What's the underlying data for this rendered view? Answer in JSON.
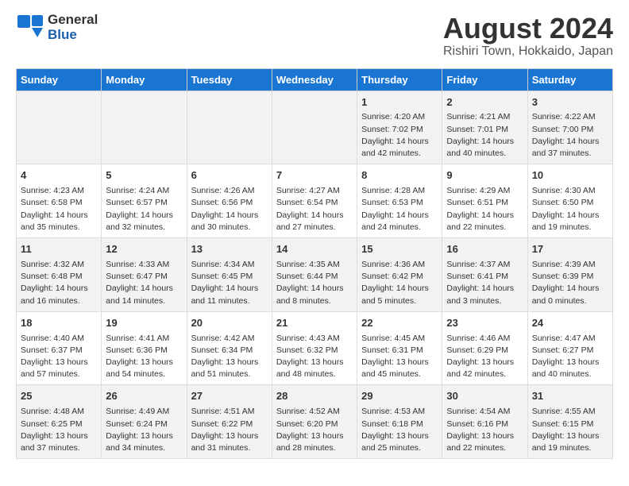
{
  "header": {
    "logo_line1": "General",
    "logo_line2": "Blue",
    "title": "August 2024",
    "subtitle": "Rishiri Town, Hokkaido, Japan"
  },
  "weekdays": [
    "Sunday",
    "Monday",
    "Tuesday",
    "Wednesday",
    "Thursday",
    "Friday",
    "Saturday"
  ],
  "weeks": [
    [
      {
        "day": "",
        "detail": ""
      },
      {
        "day": "",
        "detail": ""
      },
      {
        "day": "",
        "detail": ""
      },
      {
        "day": "",
        "detail": ""
      },
      {
        "day": "1",
        "detail": "Sunrise: 4:20 AM\nSunset: 7:02 PM\nDaylight: 14 hours and 42 minutes."
      },
      {
        "day": "2",
        "detail": "Sunrise: 4:21 AM\nSunset: 7:01 PM\nDaylight: 14 hours and 40 minutes."
      },
      {
        "day": "3",
        "detail": "Sunrise: 4:22 AM\nSunset: 7:00 PM\nDaylight: 14 hours and 37 minutes."
      }
    ],
    [
      {
        "day": "4",
        "detail": "Sunrise: 4:23 AM\nSunset: 6:58 PM\nDaylight: 14 hours and 35 minutes."
      },
      {
        "day": "5",
        "detail": "Sunrise: 4:24 AM\nSunset: 6:57 PM\nDaylight: 14 hours and 32 minutes."
      },
      {
        "day": "6",
        "detail": "Sunrise: 4:26 AM\nSunset: 6:56 PM\nDaylight: 14 hours and 30 minutes."
      },
      {
        "day": "7",
        "detail": "Sunrise: 4:27 AM\nSunset: 6:54 PM\nDaylight: 14 hours and 27 minutes."
      },
      {
        "day": "8",
        "detail": "Sunrise: 4:28 AM\nSunset: 6:53 PM\nDaylight: 14 hours and 24 minutes."
      },
      {
        "day": "9",
        "detail": "Sunrise: 4:29 AM\nSunset: 6:51 PM\nDaylight: 14 hours and 22 minutes."
      },
      {
        "day": "10",
        "detail": "Sunrise: 4:30 AM\nSunset: 6:50 PM\nDaylight: 14 hours and 19 minutes."
      }
    ],
    [
      {
        "day": "11",
        "detail": "Sunrise: 4:32 AM\nSunset: 6:48 PM\nDaylight: 14 hours and 16 minutes."
      },
      {
        "day": "12",
        "detail": "Sunrise: 4:33 AM\nSunset: 6:47 PM\nDaylight: 14 hours and 14 minutes."
      },
      {
        "day": "13",
        "detail": "Sunrise: 4:34 AM\nSunset: 6:45 PM\nDaylight: 14 hours and 11 minutes."
      },
      {
        "day": "14",
        "detail": "Sunrise: 4:35 AM\nSunset: 6:44 PM\nDaylight: 14 hours and 8 minutes."
      },
      {
        "day": "15",
        "detail": "Sunrise: 4:36 AM\nSunset: 6:42 PM\nDaylight: 14 hours and 5 minutes."
      },
      {
        "day": "16",
        "detail": "Sunrise: 4:37 AM\nSunset: 6:41 PM\nDaylight: 14 hours and 3 minutes."
      },
      {
        "day": "17",
        "detail": "Sunrise: 4:39 AM\nSunset: 6:39 PM\nDaylight: 14 hours and 0 minutes."
      }
    ],
    [
      {
        "day": "18",
        "detail": "Sunrise: 4:40 AM\nSunset: 6:37 PM\nDaylight: 13 hours and 57 minutes."
      },
      {
        "day": "19",
        "detail": "Sunrise: 4:41 AM\nSunset: 6:36 PM\nDaylight: 13 hours and 54 minutes."
      },
      {
        "day": "20",
        "detail": "Sunrise: 4:42 AM\nSunset: 6:34 PM\nDaylight: 13 hours and 51 minutes."
      },
      {
        "day": "21",
        "detail": "Sunrise: 4:43 AM\nSunset: 6:32 PM\nDaylight: 13 hours and 48 minutes."
      },
      {
        "day": "22",
        "detail": "Sunrise: 4:45 AM\nSunset: 6:31 PM\nDaylight: 13 hours and 45 minutes."
      },
      {
        "day": "23",
        "detail": "Sunrise: 4:46 AM\nSunset: 6:29 PM\nDaylight: 13 hours and 42 minutes."
      },
      {
        "day": "24",
        "detail": "Sunrise: 4:47 AM\nSunset: 6:27 PM\nDaylight: 13 hours and 40 minutes."
      }
    ],
    [
      {
        "day": "25",
        "detail": "Sunrise: 4:48 AM\nSunset: 6:25 PM\nDaylight: 13 hours and 37 minutes."
      },
      {
        "day": "26",
        "detail": "Sunrise: 4:49 AM\nSunset: 6:24 PM\nDaylight: 13 hours and 34 minutes."
      },
      {
        "day": "27",
        "detail": "Sunrise: 4:51 AM\nSunset: 6:22 PM\nDaylight: 13 hours and 31 minutes."
      },
      {
        "day": "28",
        "detail": "Sunrise: 4:52 AM\nSunset: 6:20 PM\nDaylight: 13 hours and 28 minutes."
      },
      {
        "day": "29",
        "detail": "Sunrise: 4:53 AM\nSunset: 6:18 PM\nDaylight: 13 hours and 25 minutes."
      },
      {
        "day": "30",
        "detail": "Sunrise: 4:54 AM\nSunset: 6:16 PM\nDaylight: 13 hours and 22 minutes."
      },
      {
        "day": "31",
        "detail": "Sunrise: 4:55 AM\nSunset: 6:15 PM\nDaylight: 13 hours and 19 minutes."
      }
    ]
  ]
}
